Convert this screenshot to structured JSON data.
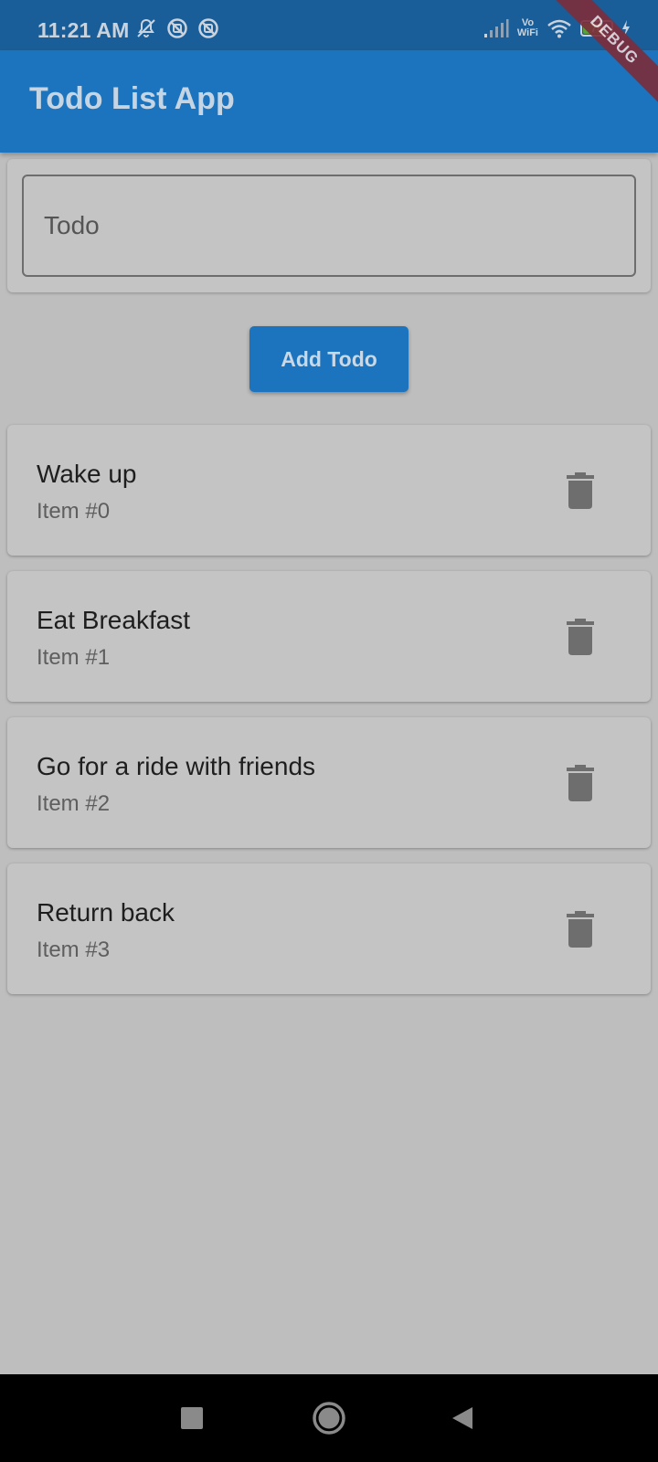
{
  "status_bar": {
    "time": "11:21 AM",
    "left_icons": [
      "bell-off-icon",
      "no-sim-icon",
      "no-sim-icon"
    ],
    "vowifi_line1": "Vo",
    "vowifi_line2": "WiFi",
    "battery_level": "76",
    "battery_fraction": 0.76
  },
  "debug_banner": "DEBUG",
  "app_bar": {
    "title": "Todo List App"
  },
  "todo_input": {
    "placeholder": "Todo",
    "value": ""
  },
  "add_button": {
    "label": "Add Todo"
  },
  "todos": [
    {
      "title": "Wake up",
      "subtitle": "Item #0"
    },
    {
      "title": "Eat Breakfast",
      "subtitle": "Item #1"
    },
    {
      "title": "Go for a ride with friends",
      "subtitle": "Item #2"
    },
    {
      "title": "Return back",
      "subtitle": "Item #3"
    }
  ],
  "colors": {
    "app_bar": "#1b74bd",
    "status_bar": "#1a5e99",
    "background": "#bebebe",
    "card": "#c4c4c4",
    "delete_icon": "#6e6e6e",
    "battery_fill": "#5aa13a",
    "debug_ribbon": "#7d2d3a"
  },
  "nav_bar": {
    "buttons": [
      "recents-icon",
      "home-icon",
      "back-icon"
    ]
  }
}
